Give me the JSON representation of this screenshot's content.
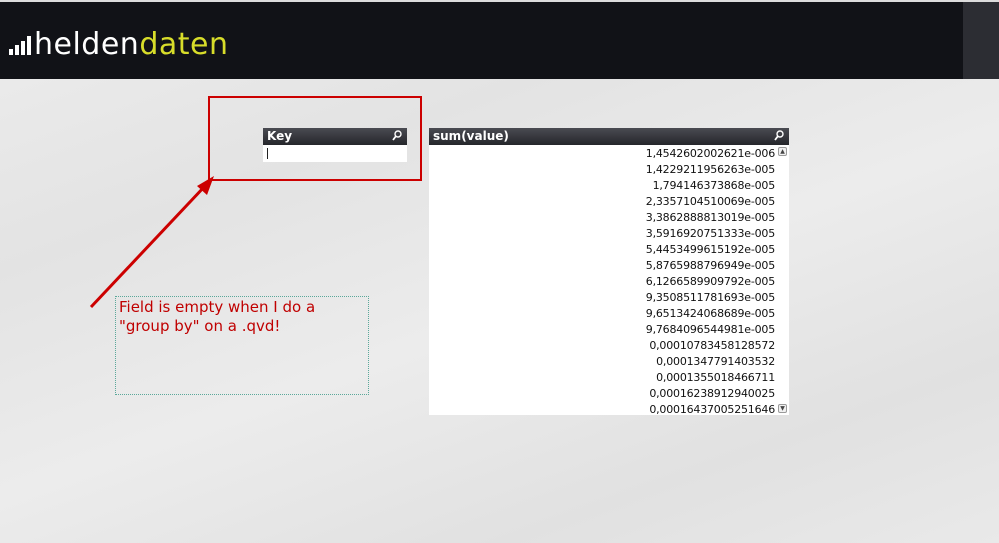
{
  "header": {
    "logo_primary": "helden",
    "logo_accent": "daten",
    "colors": {
      "background": "#111217",
      "accent": "#d8dd2a",
      "text": "#ffffff"
    }
  },
  "key_listbox": {
    "title": "Key",
    "icon": "search-icon",
    "value": ""
  },
  "sum_listbox": {
    "title": "sum(value)",
    "icon": "search-icon",
    "values": [
      "1,4542602002621e-006",
      "1,4229211956263e-005",
      "1,794146373868e-005",
      "2,3357104510069e-005",
      "3,3862888813019e-005",
      "3,5916920751333e-005",
      "5,4453499615192e-005",
      "5,8765988796949e-005",
      "6,1266589909792e-005",
      "9,3508511781693e-005",
      "9,6513424068689e-005",
      "9,7684096544981e-005",
      "0,00010783458128572",
      "0,0001347791403532",
      "0,0001355018466711",
      "0,00016238912940025",
      "0,00016437005251646"
    ],
    "scroll_icons": {
      "up": "chevron-up-icon",
      "down": "chevron-down-icon"
    }
  },
  "annotation": {
    "note": "Field is empty when I do a \"group by\" on a .qvd!",
    "color": "#cc0000"
  }
}
